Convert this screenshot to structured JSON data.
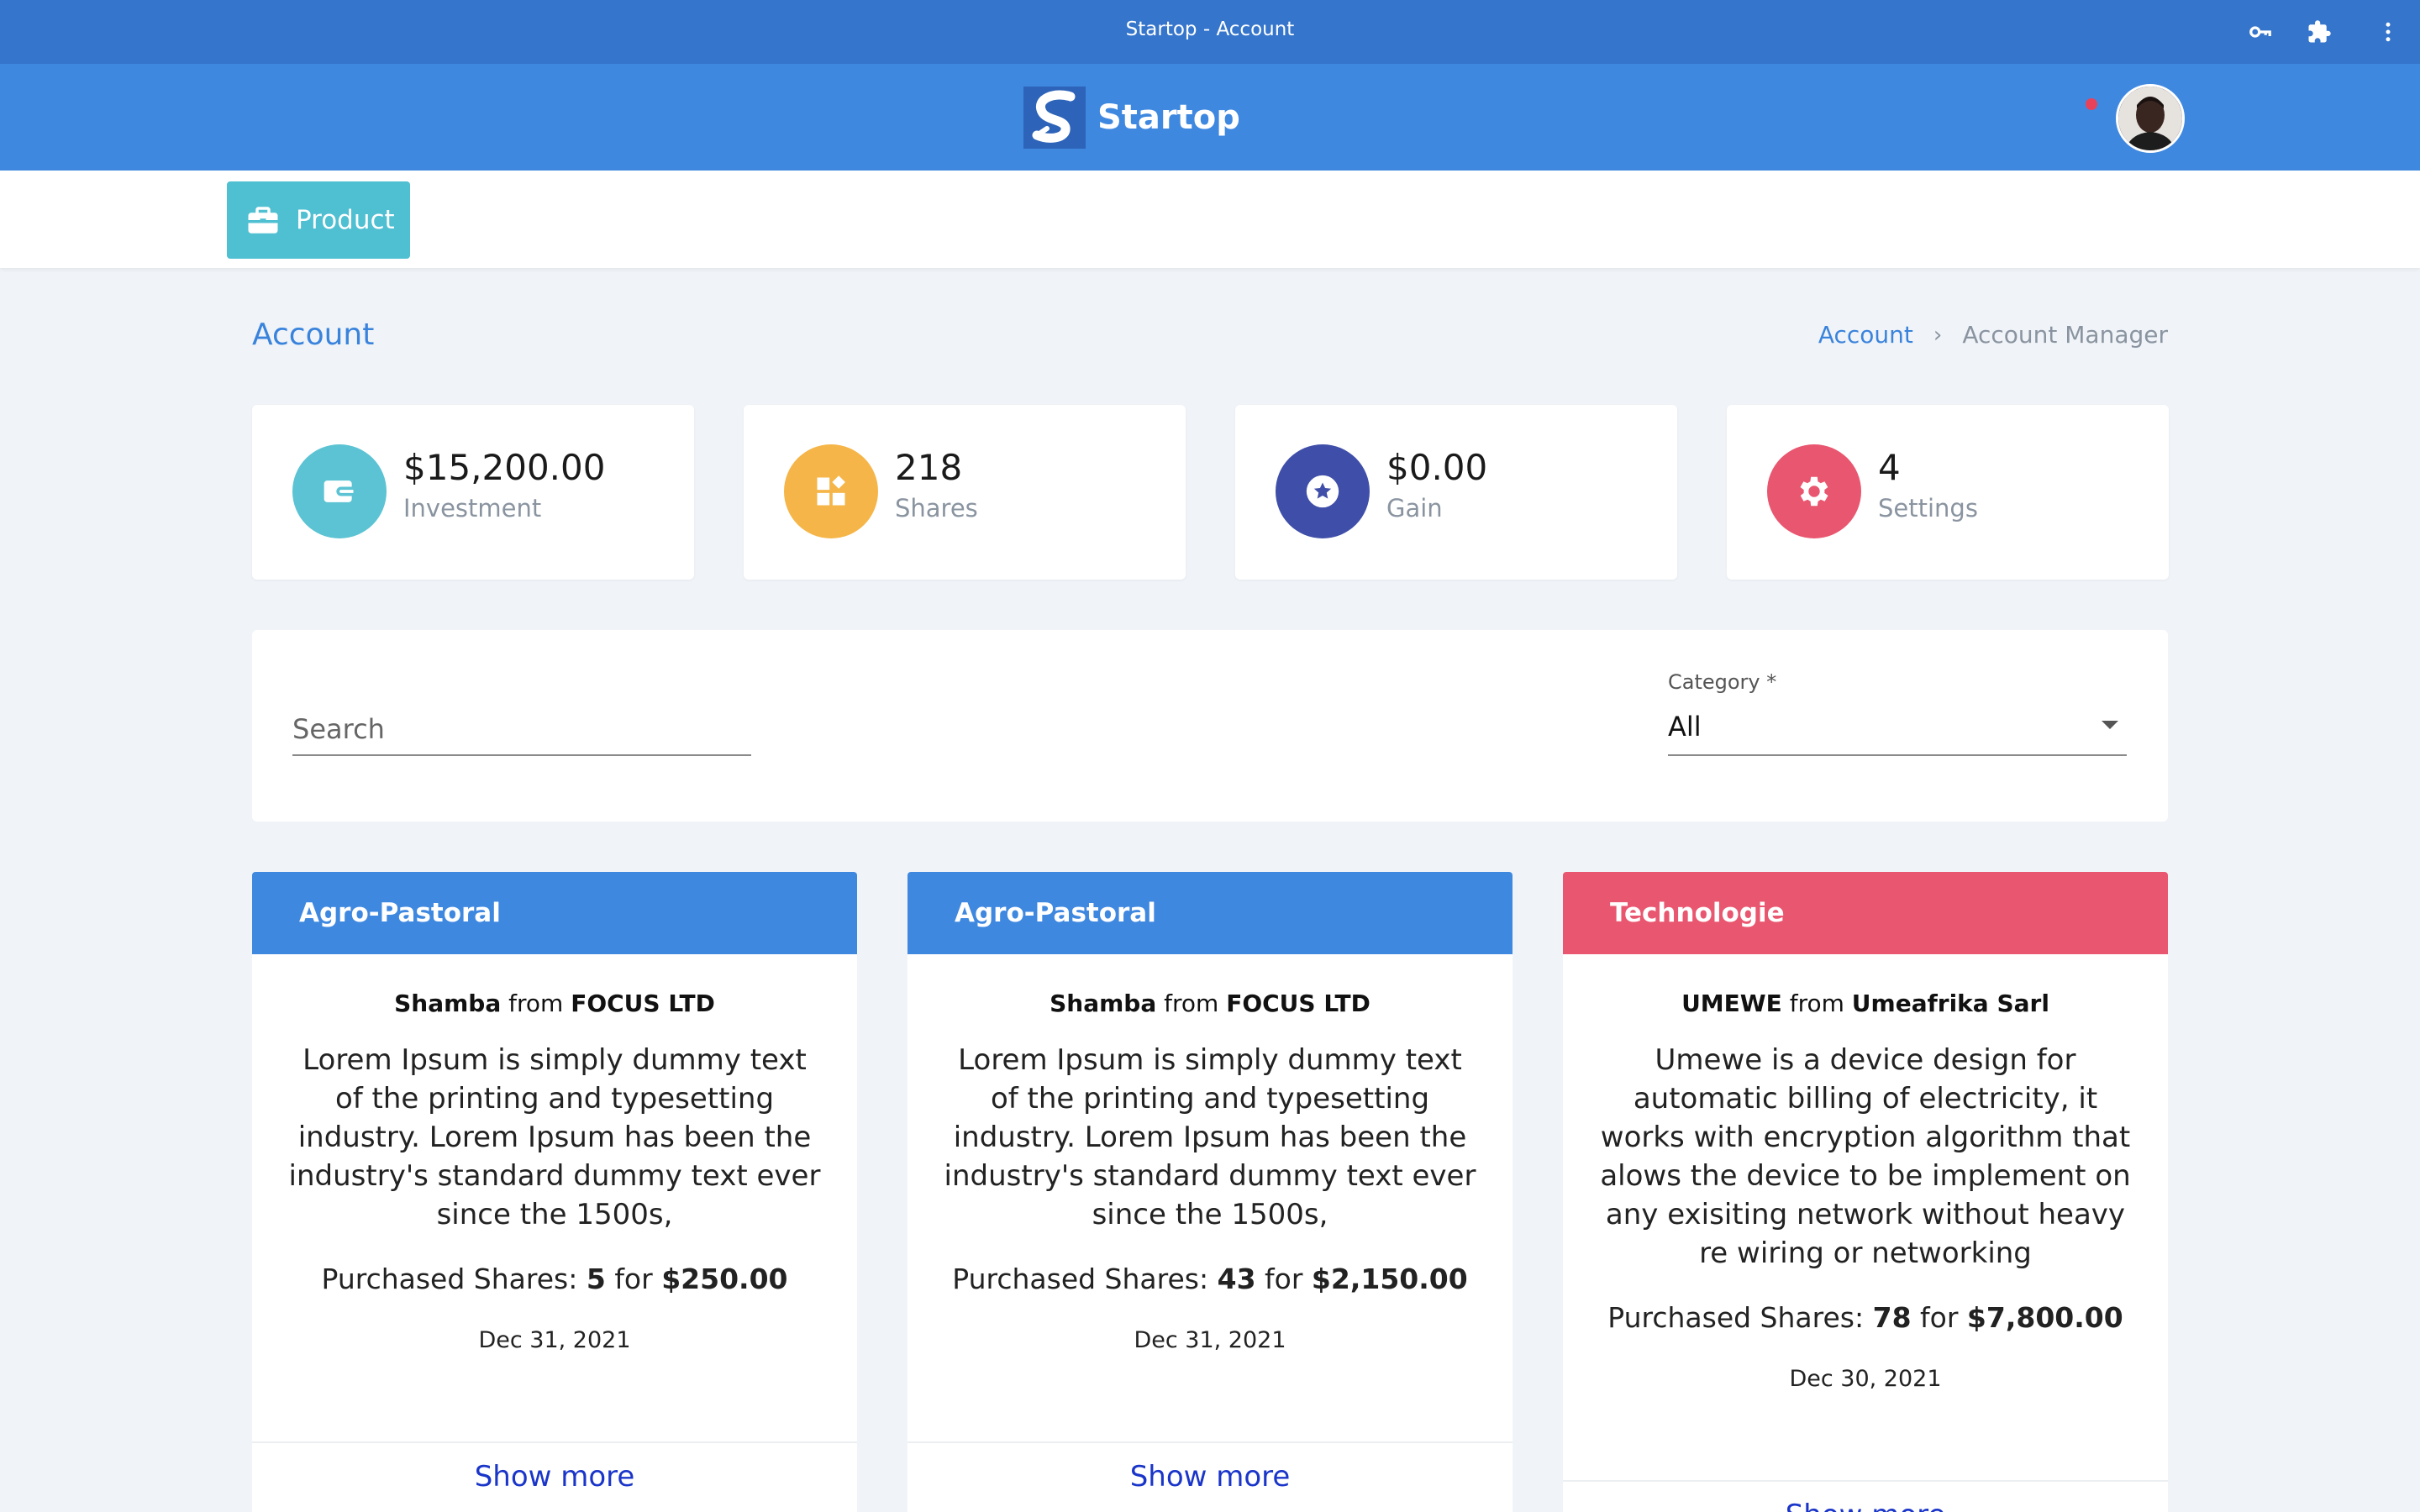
{
  "window": {
    "title": "Startop - Account"
  },
  "brand": {
    "name": "Startop"
  },
  "toolbar": {
    "product_label": "Product"
  },
  "page": {
    "title": "Account",
    "breadcrumb": {
      "link": "Account",
      "current": "Account Manager"
    }
  },
  "stats": [
    {
      "value": "$15,200.00",
      "label": "Investment",
      "icon": "wallet-icon",
      "color": "#5bc3d3"
    },
    {
      "value": "218",
      "label": "Shares",
      "icon": "widgets-icon",
      "color": "#f5b548"
    },
    {
      "value": "$0.00",
      "label": "Gain",
      "icon": "star-icon",
      "color": "#3f4ea8"
    },
    {
      "value": "4",
      "label": "Settings",
      "icon": "gear-icon",
      "color": "#e9566f"
    }
  ],
  "filters": {
    "search_placeholder": "Search",
    "category_label": "Category *",
    "category_value": "All"
  },
  "cards": [
    {
      "category": "Agro-Pastoral",
      "color": "#3f88e0",
      "product": "Shamba",
      "from": "from",
      "company": "FOCUS LTD",
      "description": "Lorem Ipsum is simply dummy text of the printing and typesetting industry. Lorem Ipsum has been the industry's standard dummy text ever since the 1500s,",
      "shares_label": "Purchased Shares:",
      "shares": "5",
      "for": "for",
      "amount": "$250.00",
      "date": "Dec 31, 2021",
      "show_more": "Show more"
    },
    {
      "category": "Agro-Pastoral",
      "color": "#3f88e0",
      "product": "Shamba",
      "from": "from",
      "company": "FOCUS LTD",
      "description": "Lorem Ipsum is simply dummy text of the printing and typesetting industry. Lorem Ipsum has been the industry's standard dummy text ever since the 1500s,",
      "shares_label": "Purchased Shares:",
      "shares": "43",
      "for": "for",
      "amount": "$2,150.00",
      "date": "Dec 31, 2021",
      "show_more": "Show more"
    },
    {
      "category": "Technologie",
      "color": "#e9566f",
      "product": "UMEWE",
      "from": "from",
      "company": "Umeafrika Sarl",
      "description": "Umewe is a device design for automatic billing of electricity, it works with encryption algorithm that alows the device to be implement on any exisiting network without heavy re wiring or networking",
      "shares_label": "Purchased Shares:",
      "shares": "78",
      "for": "for",
      "amount": "$7,800.00",
      "date": "Dec 30, 2021",
      "show_more": "Show more"
    }
  ]
}
